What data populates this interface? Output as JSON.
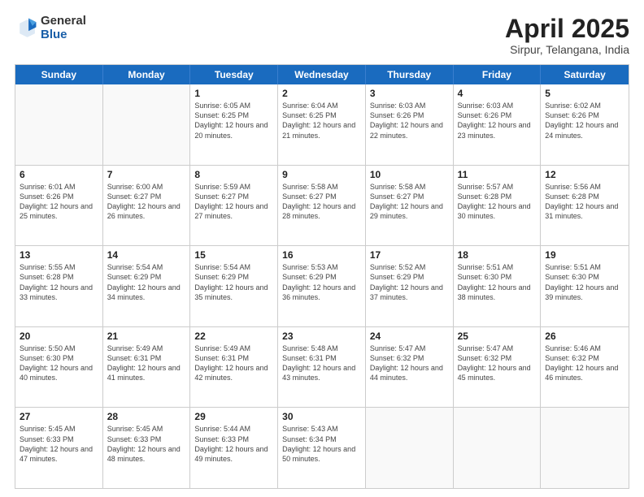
{
  "logo": {
    "general": "General",
    "blue": "Blue"
  },
  "header": {
    "title": "April 2025",
    "subtitle": "Sirpur, Telangana, India"
  },
  "weekdays": [
    "Sunday",
    "Monday",
    "Tuesday",
    "Wednesday",
    "Thursday",
    "Friday",
    "Saturday"
  ],
  "weeks": [
    [
      {
        "day": "",
        "info": ""
      },
      {
        "day": "",
        "info": ""
      },
      {
        "day": "1",
        "info": "Sunrise: 6:05 AM\nSunset: 6:25 PM\nDaylight: 12 hours and 20 minutes."
      },
      {
        "day": "2",
        "info": "Sunrise: 6:04 AM\nSunset: 6:25 PM\nDaylight: 12 hours and 21 minutes."
      },
      {
        "day": "3",
        "info": "Sunrise: 6:03 AM\nSunset: 6:26 PM\nDaylight: 12 hours and 22 minutes."
      },
      {
        "day": "4",
        "info": "Sunrise: 6:03 AM\nSunset: 6:26 PM\nDaylight: 12 hours and 23 minutes."
      },
      {
        "day": "5",
        "info": "Sunrise: 6:02 AM\nSunset: 6:26 PM\nDaylight: 12 hours and 24 minutes."
      }
    ],
    [
      {
        "day": "6",
        "info": "Sunrise: 6:01 AM\nSunset: 6:26 PM\nDaylight: 12 hours and 25 minutes."
      },
      {
        "day": "7",
        "info": "Sunrise: 6:00 AM\nSunset: 6:27 PM\nDaylight: 12 hours and 26 minutes."
      },
      {
        "day": "8",
        "info": "Sunrise: 5:59 AM\nSunset: 6:27 PM\nDaylight: 12 hours and 27 minutes."
      },
      {
        "day": "9",
        "info": "Sunrise: 5:58 AM\nSunset: 6:27 PM\nDaylight: 12 hours and 28 minutes."
      },
      {
        "day": "10",
        "info": "Sunrise: 5:58 AM\nSunset: 6:27 PM\nDaylight: 12 hours and 29 minutes."
      },
      {
        "day": "11",
        "info": "Sunrise: 5:57 AM\nSunset: 6:28 PM\nDaylight: 12 hours and 30 minutes."
      },
      {
        "day": "12",
        "info": "Sunrise: 5:56 AM\nSunset: 6:28 PM\nDaylight: 12 hours and 31 minutes."
      }
    ],
    [
      {
        "day": "13",
        "info": "Sunrise: 5:55 AM\nSunset: 6:28 PM\nDaylight: 12 hours and 33 minutes."
      },
      {
        "day": "14",
        "info": "Sunrise: 5:54 AM\nSunset: 6:29 PM\nDaylight: 12 hours and 34 minutes."
      },
      {
        "day": "15",
        "info": "Sunrise: 5:54 AM\nSunset: 6:29 PM\nDaylight: 12 hours and 35 minutes."
      },
      {
        "day": "16",
        "info": "Sunrise: 5:53 AM\nSunset: 6:29 PM\nDaylight: 12 hours and 36 minutes."
      },
      {
        "day": "17",
        "info": "Sunrise: 5:52 AM\nSunset: 6:29 PM\nDaylight: 12 hours and 37 minutes."
      },
      {
        "day": "18",
        "info": "Sunrise: 5:51 AM\nSunset: 6:30 PM\nDaylight: 12 hours and 38 minutes."
      },
      {
        "day": "19",
        "info": "Sunrise: 5:51 AM\nSunset: 6:30 PM\nDaylight: 12 hours and 39 minutes."
      }
    ],
    [
      {
        "day": "20",
        "info": "Sunrise: 5:50 AM\nSunset: 6:30 PM\nDaylight: 12 hours and 40 minutes."
      },
      {
        "day": "21",
        "info": "Sunrise: 5:49 AM\nSunset: 6:31 PM\nDaylight: 12 hours and 41 minutes."
      },
      {
        "day": "22",
        "info": "Sunrise: 5:49 AM\nSunset: 6:31 PM\nDaylight: 12 hours and 42 minutes."
      },
      {
        "day": "23",
        "info": "Sunrise: 5:48 AM\nSunset: 6:31 PM\nDaylight: 12 hours and 43 minutes."
      },
      {
        "day": "24",
        "info": "Sunrise: 5:47 AM\nSunset: 6:32 PM\nDaylight: 12 hours and 44 minutes."
      },
      {
        "day": "25",
        "info": "Sunrise: 5:47 AM\nSunset: 6:32 PM\nDaylight: 12 hours and 45 minutes."
      },
      {
        "day": "26",
        "info": "Sunrise: 5:46 AM\nSunset: 6:32 PM\nDaylight: 12 hours and 46 minutes."
      }
    ],
    [
      {
        "day": "27",
        "info": "Sunrise: 5:45 AM\nSunset: 6:33 PM\nDaylight: 12 hours and 47 minutes."
      },
      {
        "day": "28",
        "info": "Sunrise: 5:45 AM\nSunset: 6:33 PM\nDaylight: 12 hours and 48 minutes."
      },
      {
        "day": "29",
        "info": "Sunrise: 5:44 AM\nSunset: 6:33 PM\nDaylight: 12 hours and 49 minutes."
      },
      {
        "day": "30",
        "info": "Sunrise: 5:43 AM\nSunset: 6:34 PM\nDaylight: 12 hours and 50 minutes."
      },
      {
        "day": "",
        "info": ""
      },
      {
        "day": "",
        "info": ""
      },
      {
        "day": "",
        "info": ""
      }
    ]
  ]
}
